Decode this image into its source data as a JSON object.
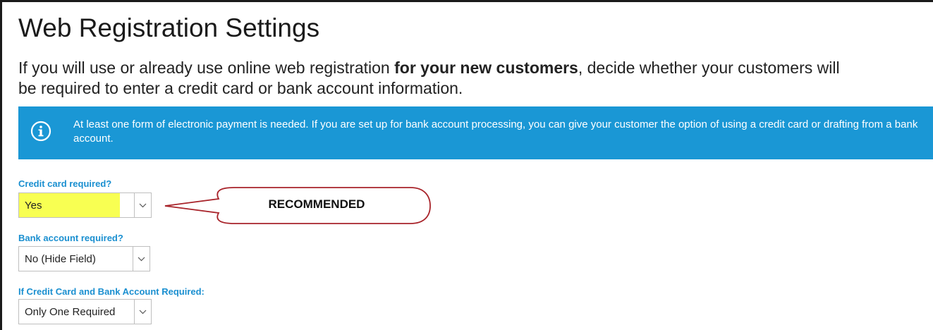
{
  "page": {
    "title": "Web Registration Settings",
    "intro": {
      "part1": "If you will use or already use online web registration ",
      "bold": "for your new customers",
      "part2": ", decide whether your customers will",
      "line2": "be required to enter a credit card or bank account information."
    }
  },
  "info_banner": {
    "icon": "info-circle-icon",
    "text": "At least one form of electronic payment is needed. If you are set up for bank account processing, you can give your customer the option of using a credit card or drafting from a bank account.",
    "background": "#1a97d5"
  },
  "fields": {
    "credit_card": {
      "label": "Credit card required?",
      "value": "Yes",
      "highlight_color": "#f8ff52"
    },
    "bank_account": {
      "label": "Bank account required?",
      "value": "No (Hide Field)"
    },
    "both_required": {
      "label": "If Credit Card and Bank Account Required:",
      "value": "Only One Required"
    }
  },
  "annotation": {
    "text": "RECOMMENDED",
    "color": "#a8232a"
  },
  "colors": {
    "label_blue": "#1a8fd0"
  }
}
